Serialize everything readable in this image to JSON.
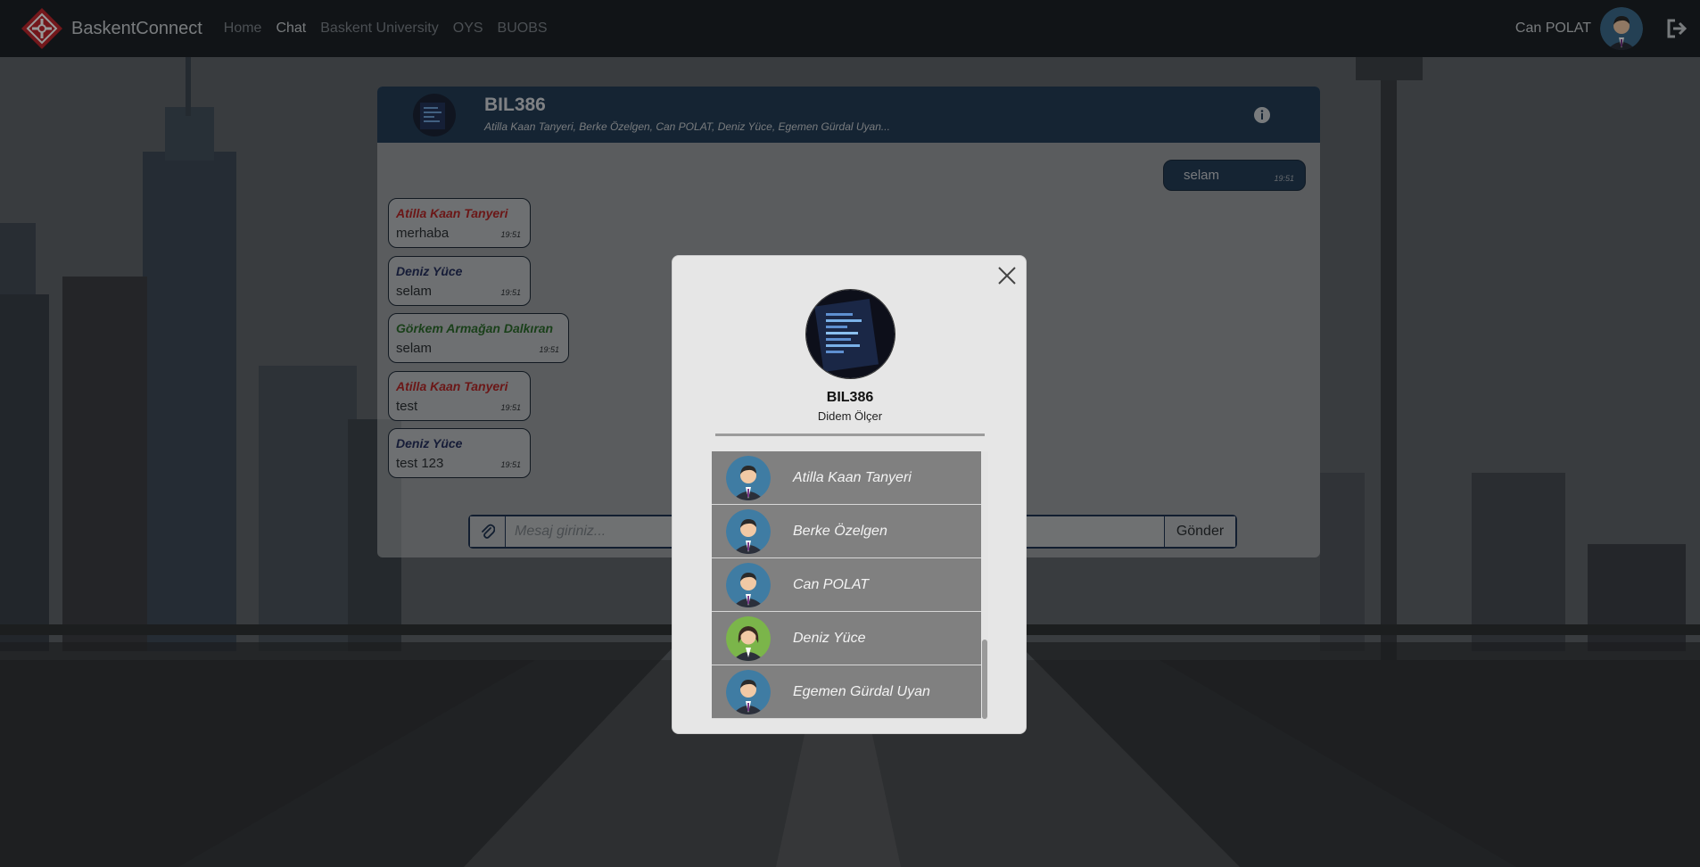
{
  "navbar": {
    "brand": "BaskentConnect",
    "links": [
      {
        "label": "Home",
        "active": false
      },
      {
        "label": "Chat",
        "active": true
      },
      {
        "label": "Baskent University",
        "active": false
      },
      {
        "label": "OYS",
        "active": false
      },
      {
        "label": "BUOBS",
        "active": false
      }
    ],
    "user_name": "Can POLAT",
    "logout_icon": "logout-icon"
  },
  "chat": {
    "title": "BIL386",
    "members_line": "Atilla Kaan Tanyeri, Berke Özelgen, Can POLAT, Deniz Yüce, Egemen Gürdal Uyan...",
    "info_icon": "info-icon",
    "own_message": {
      "text": "selam",
      "time": "19:51"
    },
    "messages": [
      {
        "sender": "Atilla Kaan Tanyeri",
        "sender_color": "#b32727",
        "text": "merhaba",
        "time": "19:51"
      },
      {
        "sender": "Deniz Yüce",
        "sender_color": "#25305d",
        "text": "selam",
        "time": "19:51"
      },
      {
        "sender": "Görkem Armağan Dalkıran",
        "sender_color": "#2c6b2c",
        "text": "selam",
        "time": "19:51"
      },
      {
        "sender": "Atilla Kaan Tanyeri",
        "sender_color": "#b32727",
        "text": "test",
        "time": "19:51"
      },
      {
        "sender": "Deniz Yüce",
        "sender_color": "#25305d",
        "text": "test 123",
        "time": "19:51"
      }
    ],
    "input_placeholder": "Mesaj giriniz...",
    "send_label": "Gönder",
    "attach_icon": "paperclip-icon"
  },
  "modal": {
    "title": "BIL386",
    "subtitle": "Didem Ölçer",
    "close_icon": "close-icon",
    "members": [
      {
        "name": "Atilla Kaan Tanyeri",
        "avatar": "male"
      },
      {
        "name": "Berke Özelgen",
        "avatar": "male"
      },
      {
        "name": "Can POLAT",
        "avatar": "male"
      },
      {
        "name": "Deniz Yüce",
        "avatar": "female"
      },
      {
        "name": "Egemen Gürdal Uyan",
        "avatar": "male"
      }
    ]
  },
  "colors": {
    "navbar": "#1d2227",
    "chat_header": "#233c56",
    "modal_bg": "#e6e6e6",
    "member_row": "#808080"
  }
}
